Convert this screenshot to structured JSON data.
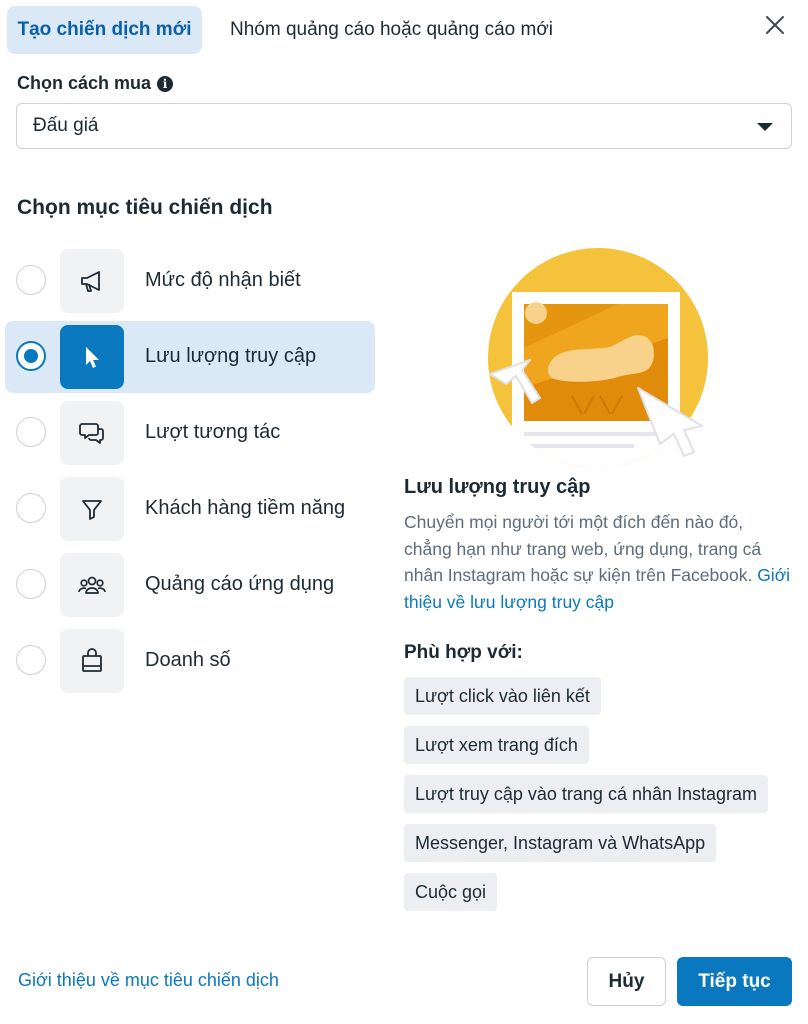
{
  "tabs": {
    "active_label": "Tạo chiến dịch mới",
    "inactive_label": "Nhóm quảng cáo hoặc quảng cáo mới"
  },
  "buy_type": {
    "label": "Chọn cách mua",
    "selected_value": "Đấu giá"
  },
  "objective": {
    "section_title": "Chọn mục tiêu chiến dịch",
    "options": [
      {
        "label": "Mức độ nhận biết",
        "icon": "megaphone-icon",
        "selected": false
      },
      {
        "label": "Lưu lượng truy cập",
        "icon": "cursor-icon",
        "selected": true
      },
      {
        "label": "Lượt tương tác",
        "icon": "chat-bubbles-icon",
        "selected": false
      },
      {
        "label": "Khách hàng tiềm năng",
        "icon": "funnel-icon",
        "selected": false
      },
      {
        "label": "Quảng cáo ứng dụng",
        "icon": "people-group-icon",
        "selected": false
      },
      {
        "label": "Doanh số",
        "icon": "shopping-bag-icon",
        "selected": false
      }
    ]
  },
  "detail": {
    "title": "Lưu lượng truy cập",
    "description": "Chuyển mọi người tới một đích đến nào đó, chẳng hạn như trang web, ứng dụng, trang cá nhân Instagram hoặc sự kiện trên Facebook.",
    "learn_more_link": "Giới thiệu về lưu lượng truy cập",
    "fits_title": "Phù hợp với:",
    "fits": [
      "Lượt click vào liên kết",
      "Lượt xem trang đích",
      "Lượt truy cập vào trang cá nhân Instagram",
      "Messenger, Instagram và WhatsApp",
      "Cuộc gọi"
    ]
  },
  "footer": {
    "about_link": "Giới thiệu về mục tiêu chiến dịch",
    "cancel_label": "Hủy",
    "continue_label": "Tiếp tục"
  },
  "colors": {
    "accent": "#0a78be",
    "selected_bg": "#dbe9f6",
    "illustration_yellow": "#f5c33b"
  }
}
